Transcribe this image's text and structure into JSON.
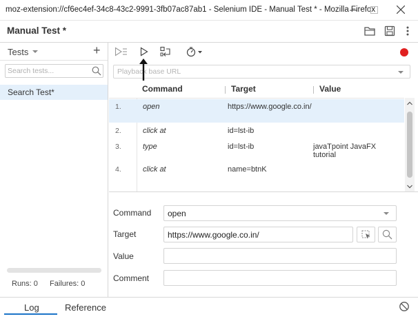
{
  "window": {
    "title": "moz-extension://cf6ec4ef-34c8-43c2-9991-3fb07ac87ab1 - Selenium IDE - Manual Test * - Mozilla Firefox",
    "minimize_icon": "minimize-icon",
    "maximize_icon": "maximize-icon",
    "close_icon": "close-icon"
  },
  "project": {
    "title": "Manual Test *",
    "icons": [
      "open-folder-icon",
      "save-icon",
      "more-vertical-icon"
    ]
  },
  "sidebar": {
    "header_label": "Tests",
    "add_label": "+",
    "search_placeholder": "Search tests...",
    "tests": [
      {
        "label": "Search Test*",
        "selected": true
      }
    ],
    "stats": {
      "runs": "Runs: 0",
      "failures": "Failures: 0"
    }
  },
  "toolbar": {
    "icons": [
      "run-all-icon",
      "run-test-icon",
      "step-over-icon",
      "speed-icon",
      "record-icon"
    ],
    "record_color": "#e02020"
  },
  "base_url": {
    "placeholder": "Playback base URL",
    "value": ""
  },
  "table": {
    "columns": [
      "Command",
      "Target",
      "Value"
    ],
    "rows": [
      {
        "num": "1.",
        "command": "open",
        "target": "https://www.google.co.in/",
        "value": "",
        "selected": true
      },
      {
        "num": "2.",
        "command": "click at",
        "target": "id=lst-ib",
        "value": ""
      },
      {
        "num": "3.",
        "command": "type",
        "target": "id=lst-ib",
        "value": "javaTpoint JavaFX tutorial"
      },
      {
        "num": "4.",
        "command": "click at",
        "target": "name=btnK",
        "value": ""
      }
    ]
  },
  "editor": {
    "command_label": "Command",
    "command_value": "open",
    "target_label": "Target",
    "target_value": "https://www.google.co.in/",
    "value_label": "Value",
    "value_value": "",
    "comment_label": "Comment",
    "comment_value": ""
  },
  "bottom": {
    "tabs": [
      {
        "label": "Log",
        "active": true
      },
      {
        "label": "Reference",
        "active": false
      }
    ]
  },
  "colors": {
    "selection": "#e4f0fb",
    "accent": "#1a73c8",
    "record": "#e02020"
  }
}
